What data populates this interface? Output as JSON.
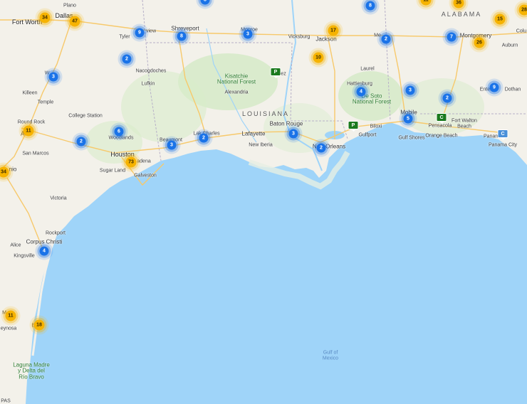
{
  "map": {
    "colors": {
      "water": "#9fd4f9",
      "land": "#f3f1ea",
      "forest": "#cfe8c0",
      "road": "#f7c96b",
      "cluster_small": "#1a73e8",
      "cluster_large": "#f6b300",
      "poi_green": "#1b7a1e",
      "poi_blue": "#4a90d9"
    },
    "regions": [
      {
        "id": "louisiana",
        "text": "LOUISIANA"
      },
      {
        "id": "alabama",
        "text": "ALABAMA"
      }
    ],
    "parks": [
      {
        "id": "kisatchie",
        "line1": "Kisatchie",
        "line2": "National Forest"
      },
      {
        "id": "desoto",
        "line1": "De Soto",
        "line2": "National Forest"
      }
    ],
    "water": {
      "line1": "Gulf of",
      "line2": "Mexico"
    },
    "lagoon": {
      "line1": "Laguna Madre",
      "line2": "y Delta del",
      "line3": "Río Bravo"
    },
    "cities": [
      {
        "id": "fort-worth",
        "text": "Fort Worth",
        "size": "major"
      },
      {
        "id": "dallas",
        "text": "Dallas",
        "size": "major"
      },
      {
        "id": "plano",
        "text": "Plano",
        "size": "minor"
      },
      {
        "id": "tyler",
        "text": "Tyler",
        "size": "minor"
      },
      {
        "id": "longview",
        "text": "view",
        "size": "minor"
      },
      {
        "id": "shreveport",
        "text": "Shreveport",
        "size": "medium"
      },
      {
        "id": "monroe",
        "text": "Monroe",
        "size": "minor"
      },
      {
        "id": "vicksburg",
        "text": "Vicksburg",
        "size": "minor"
      },
      {
        "id": "jackson",
        "text": "Jackson",
        "size": "medium"
      },
      {
        "id": "meridian",
        "text": "Me",
        "size": "minor"
      },
      {
        "id": "montgomery",
        "text": "Montgomery",
        "size": "medium"
      },
      {
        "id": "auburn",
        "text": "Auburn",
        "size": "minor"
      },
      {
        "id": "columbus",
        "text": "Colu",
        "size": "minor"
      },
      {
        "id": "nacogdoches",
        "text": "Nacogdoches",
        "size": "minor"
      },
      {
        "id": "lufkin",
        "text": "Lufkin",
        "size": "minor"
      },
      {
        "id": "alexandria",
        "text": "Alexandria",
        "size": "minor"
      },
      {
        "id": "natchez",
        "text": "ez",
        "size": "minor"
      },
      {
        "id": "laurel",
        "text": "Laurel",
        "size": "minor"
      },
      {
        "id": "hattiesburg",
        "text": "Hattiesburg",
        "size": "minor"
      },
      {
        "id": "enterprise",
        "text": "Enterp",
        "size": "minor"
      },
      {
        "id": "dothan",
        "text": "Dothan",
        "size": "minor"
      },
      {
        "id": "waco",
        "text": "W",
        "size": "minor"
      },
      {
        "id": "killeen",
        "text": "Killeen",
        "size": "minor"
      },
      {
        "id": "temple",
        "text": "Temple",
        "size": "minor"
      },
      {
        "id": "college-station",
        "text": "College Station",
        "size": "minor"
      },
      {
        "id": "round-rock",
        "text": "Round Rock",
        "size": "minor"
      },
      {
        "id": "austin",
        "text": "Au",
        "size": "medium"
      },
      {
        "id": "san-marcos",
        "text": "San Marcos",
        "size": "minor"
      },
      {
        "id": "san-antonio",
        "text": "nio",
        "size": "medium"
      },
      {
        "id": "woodlands",
        "text": "Woodlands",
        "size": "minor"
      },
      {
        "id": "houston",
        "text": "Houston",
        "size": "major"
      },
      {
        "id": "pasadena",
        "text": "adena",
        "size": "minor"
      },
      {
        "id": "sugar-land",
        "text": "Sugar Land",
        "size": "minor"
      },
      {
        "id": "galveston",
        "text": "Galveston",
        "size": "minor"
      },
      {
        "id": "beaumont",
        "text": "Beaumont",
        "size": "minor"
      },
      {
        "id": "lake-charles",
        "text": "Lak   Charles",
        "size": "minor"
      },
      {
        "id": "lafayette",
        "text": "Lafayette",
        "size": "medium"
      },
      {
        "id": "new-iberia",
        "text": "New Iberia",
        "size": "minor"
      },
      {
        "id": "baton-rouge",
        "text": "Baton Rouge",
        "size": "medium"
      },
      {
        "id": "new-orleans",
        "text": "New Orleans",
        "size": "medium"
      },
      {
        "id": "gulfport",
        "text": "Gulfport",
        "size": "minor"
      },
      {
        "id": "biloxi",
        "text": "Biloxi",
        "size": "minor"
      },
      {
        "id": "mobile",
        "text": "Mobile",
        "size": "medium"
      },
      {
        "id": "pensacola",
        "text": "Pensacola",
        "size": "minor"
      },
      {
        "id": "gulf-shores",
        "text": "Gulf Shores",
        "size": "minor"
      },
      {
        "id": "orange-beach",
        "text": "Orange Beach",
        "size": "minor"
      },
      {
        "id": "fort-walton",
        "text": "Fort Walton",
        "size": "minor"
      },
      {
        "id": "fort-walton-2",
        "text": "Beach",
        "size": "minor"
      },
      {
        "id": "panama-city",
        "text": "Panama City",
        "size": "minor"
      },
      {
        "id": "panama-city-beach",
        "text": "Panama",
        "size": "minor"
      },
      {
        "id": "victoria",
        "text": "Victoria",
        "size": "minor"
      },
      {
        "id": "rockport",
        "text": "Rockport",
        "size": "minor"
      },
      {
        "id": "corpus-christi",
        "text": "Corpus Christi",
        "size": "medium"
      },
      {
        "id": "alice",
        "text": "Alice",
        "size": "minor"
      },
      {
        "id": "kingsville",
        "text": "Kingsville",
        "size": "minor"
      },
      {
        "id": "reynosa",
        "text": "eynosa",
        "size": "minor"
      },
      {
        "id": "mcallen",
        "text": "M",
        "size": "minor"
      },
      {
        "id": "brownsville",
        "text": "Br",
        "size": "minor"
      },
      {
        "id": "tamaulipas",
        "text": "PAS",
        "size": "minor"
      }
    ],
    "clusters": [
      {
        "id": "c-dallas-34",
        "count": "34",
        "color": "yellow"
      },
      {
        "id": "c-dallas-47",
        "count": "47",
        "color": "yellow"
      },
      {
        "id": "c-top-8a",
        "count": "8",
        "color": "blue"
      },
      {
        "id": "c-top-8b",
        "count": "8",
        "color": "blue"
      },
      {
        "id": "c-top-11",
        "count": "11",
        "color": "yellow"
      },
      {
        "id": "c-top-36",
        "count": "36",
        "color": "yellow"
      },
      {
        "id": "c-top-28",
        "count": "28",
        "color": "yellow"
      },
      {
        "id": "c-tyler-9",
        "count": "9",
        "color": "blue"
      },
      {
        "id": "c-shreveport-8",
        "count": "8",
        "color": "blue"
      },
      {
        "id": "c-monroe-3",
        "count": "3",
        "color": "blue"
      },
      {
        "id": "c-jackson-17",
        "count": "17",
        "color": "yellow"
      },
      {
        "id": "c-meridian-2",
        "count": "2",
        "color": "blue"
      },
      {
        "id": "c-alabama-7",
        "count": "7",
        "color": "blue"
      },
      {
        "id": "c-montgomery-26",
        "count": "26",
        "color": "yellow"
      },
      {
        "id": "c-auburn-15",
        "count": "15",
        "color": "yellow"
      },
      {
        "id": "c-jackson-10",
        "count": "10",
        "color": "yellow"
      },
      {
        "id": "c-nacogdoches-2",
        "count": "2",
        "color": "blue"
      },
      {
        "id": "c-waco-3",
        "count": "3",
        "color": "blue"
      },
      {
        "id": "c-hattiesburg-4",
        "count": "4",
        "color": "blue"
      },
      {
        "id": "c-alabama-3",
        "count": "3",
        "color": "blue"
      },
      {
        "id": "c-mobile-2",
        "count": "2",
        "color": "blue"
      },
      {
        "id": "c-enterprise-9",
        "count": "9",
        "color": "blue"
      },
      {
        "id": "c-austin-11",
        "count": "11",
        "color": "yellow"
      },
      {
        "id": "c-woodlands-6",
        "count": "6",
        "color": "blue"
      },
      {
        "id": "c-college-2",
        "count": "2",
        "color": "blue"
      },
      {
        "id": "c-beaumont-3",
        "count": "3",
        "color": "blue"
      },
      {
        "id": "c-lakecharles-2",
        "count": "2",
        "color": "blue"
      },
      {
        "id": "c-batonrouge-3",
        "count": "3",
        "color": "blue"
      },
      {
        "id": "c-neworleans-2",
        "count": "2",
        "color": "blue"
      },
      {
        "id": "c-mobile-5",
        "count": "5",
        "color": "blue"
      },
      {
        "id": "c-houston-73",
        "count": "73",
        "color": "yellow"
      },
      {
        "id": "c-sanantonio-34",
        "count": "34",
        "color": "yellow"
      },
      {
        "id": "c-corpus-4",
        "count": "4",
        "color": "blue"
      },
      {
        "id": "c-mcallen-11",
        "count": "11",
        "color": "yellow"
      },
      {
        "id": "c-brownsville-18",
        "count": "18",
        "color": "yellow"
      }
    ],
    "pois": [
      {
        "id": "poi-kisatchie",
        "letter": "P",
        "color": "green"
      },
      {
        "id": "poi-gulfport",
        "letter": "P",
        "color": "green"
      },
      {
        "id": "poi-pensacola",
        "letter": "C",
        "color": "green"
      },
      {
        "id": "poi-panama",
        "letter": "C",
        "color": "blue"
      }
    ],
    "shields": [
      "20",
      "45",
      "30",
      "35",
      "49",
      "69",
      "59",
      "65",
      "85",
      "10",
      "12",
      "37",
      "55",
      "75",
      "77",
      "83",
      "2",
      "101",
      "14"
    ]
  }
}
